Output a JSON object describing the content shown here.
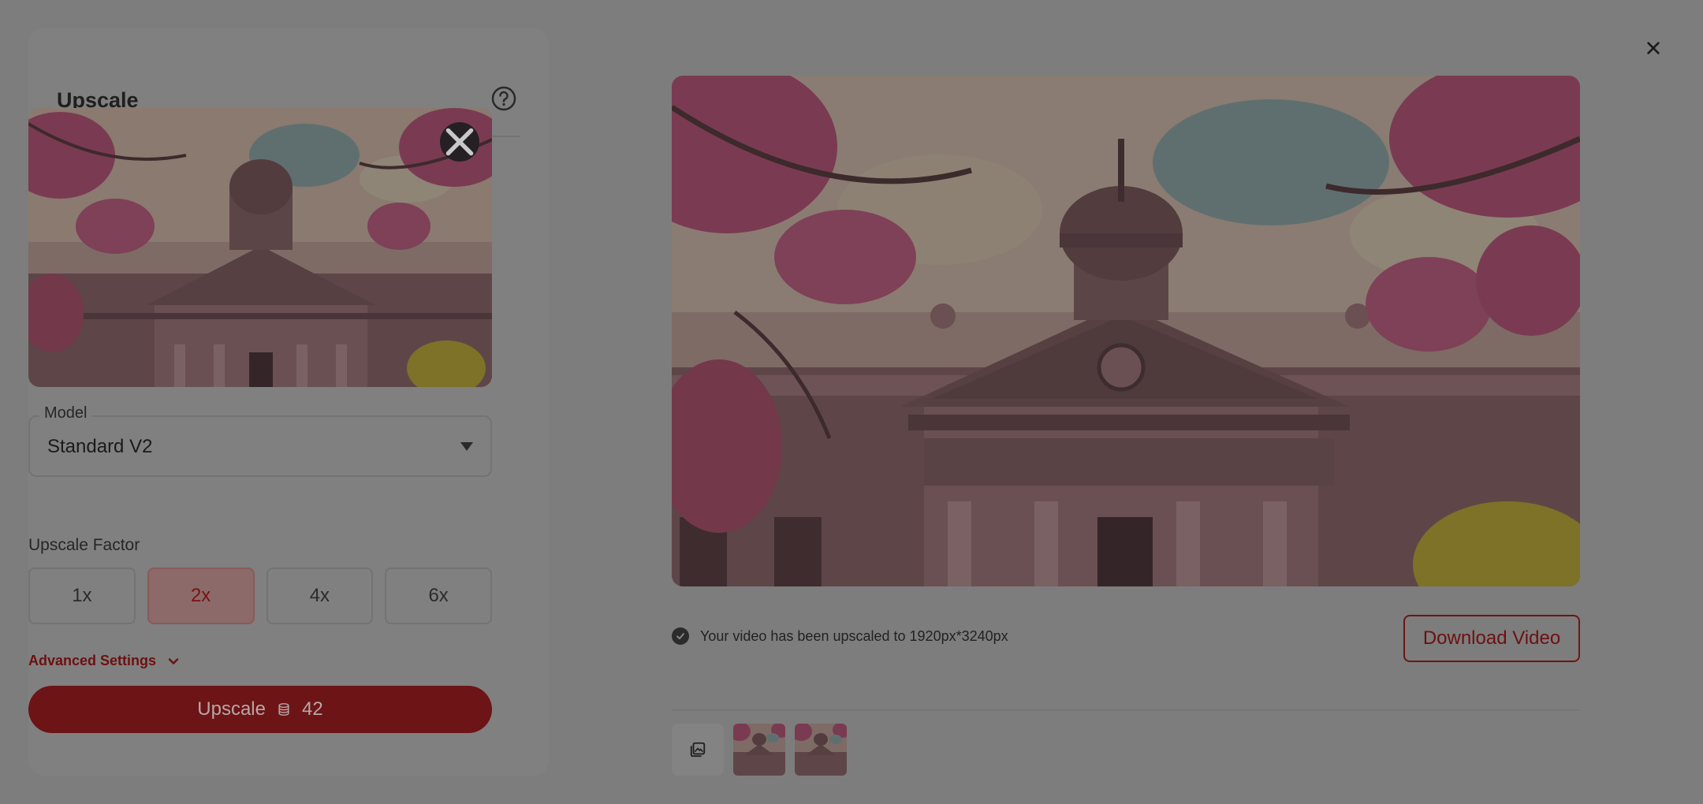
{
  "panel": {
    "title": "Upscale",
    "help_icon": "question-circle-icon",
    "thumbnail_close_icon": "close-icon"
  },
  "model": {
    "label": "Model",
    "value": "Standard V2",
    "caret_icon": "caret-down-icon"
  },
  "factor": {
    "label": "Upscale Factor",
    "options": [
      "1x",
      "2x",
      "4x",
      "6x"
    ],
    "selected": "2x"
  },
  "advanced": {
    "label": "Advanced Settings",
    "icon": "chevron-down-icon"
  },
  "upscale_button": {
    "label": "Upscale",
    "credits": "42",
    "icon": "coins-icon"
  },
  "result": {
    "status_text": "Your video has been upscaled to 1920px*3240px",
    "status_icon": "check-circle-icon",
    "download_label": "Download Video",
    "close_icon": "close-icon",
    "history_icon": "gallery-icon"
  },
  "colors": {
    "accent": "#6c1416",
    "overlay": "#7d7d7d"
  }
}
